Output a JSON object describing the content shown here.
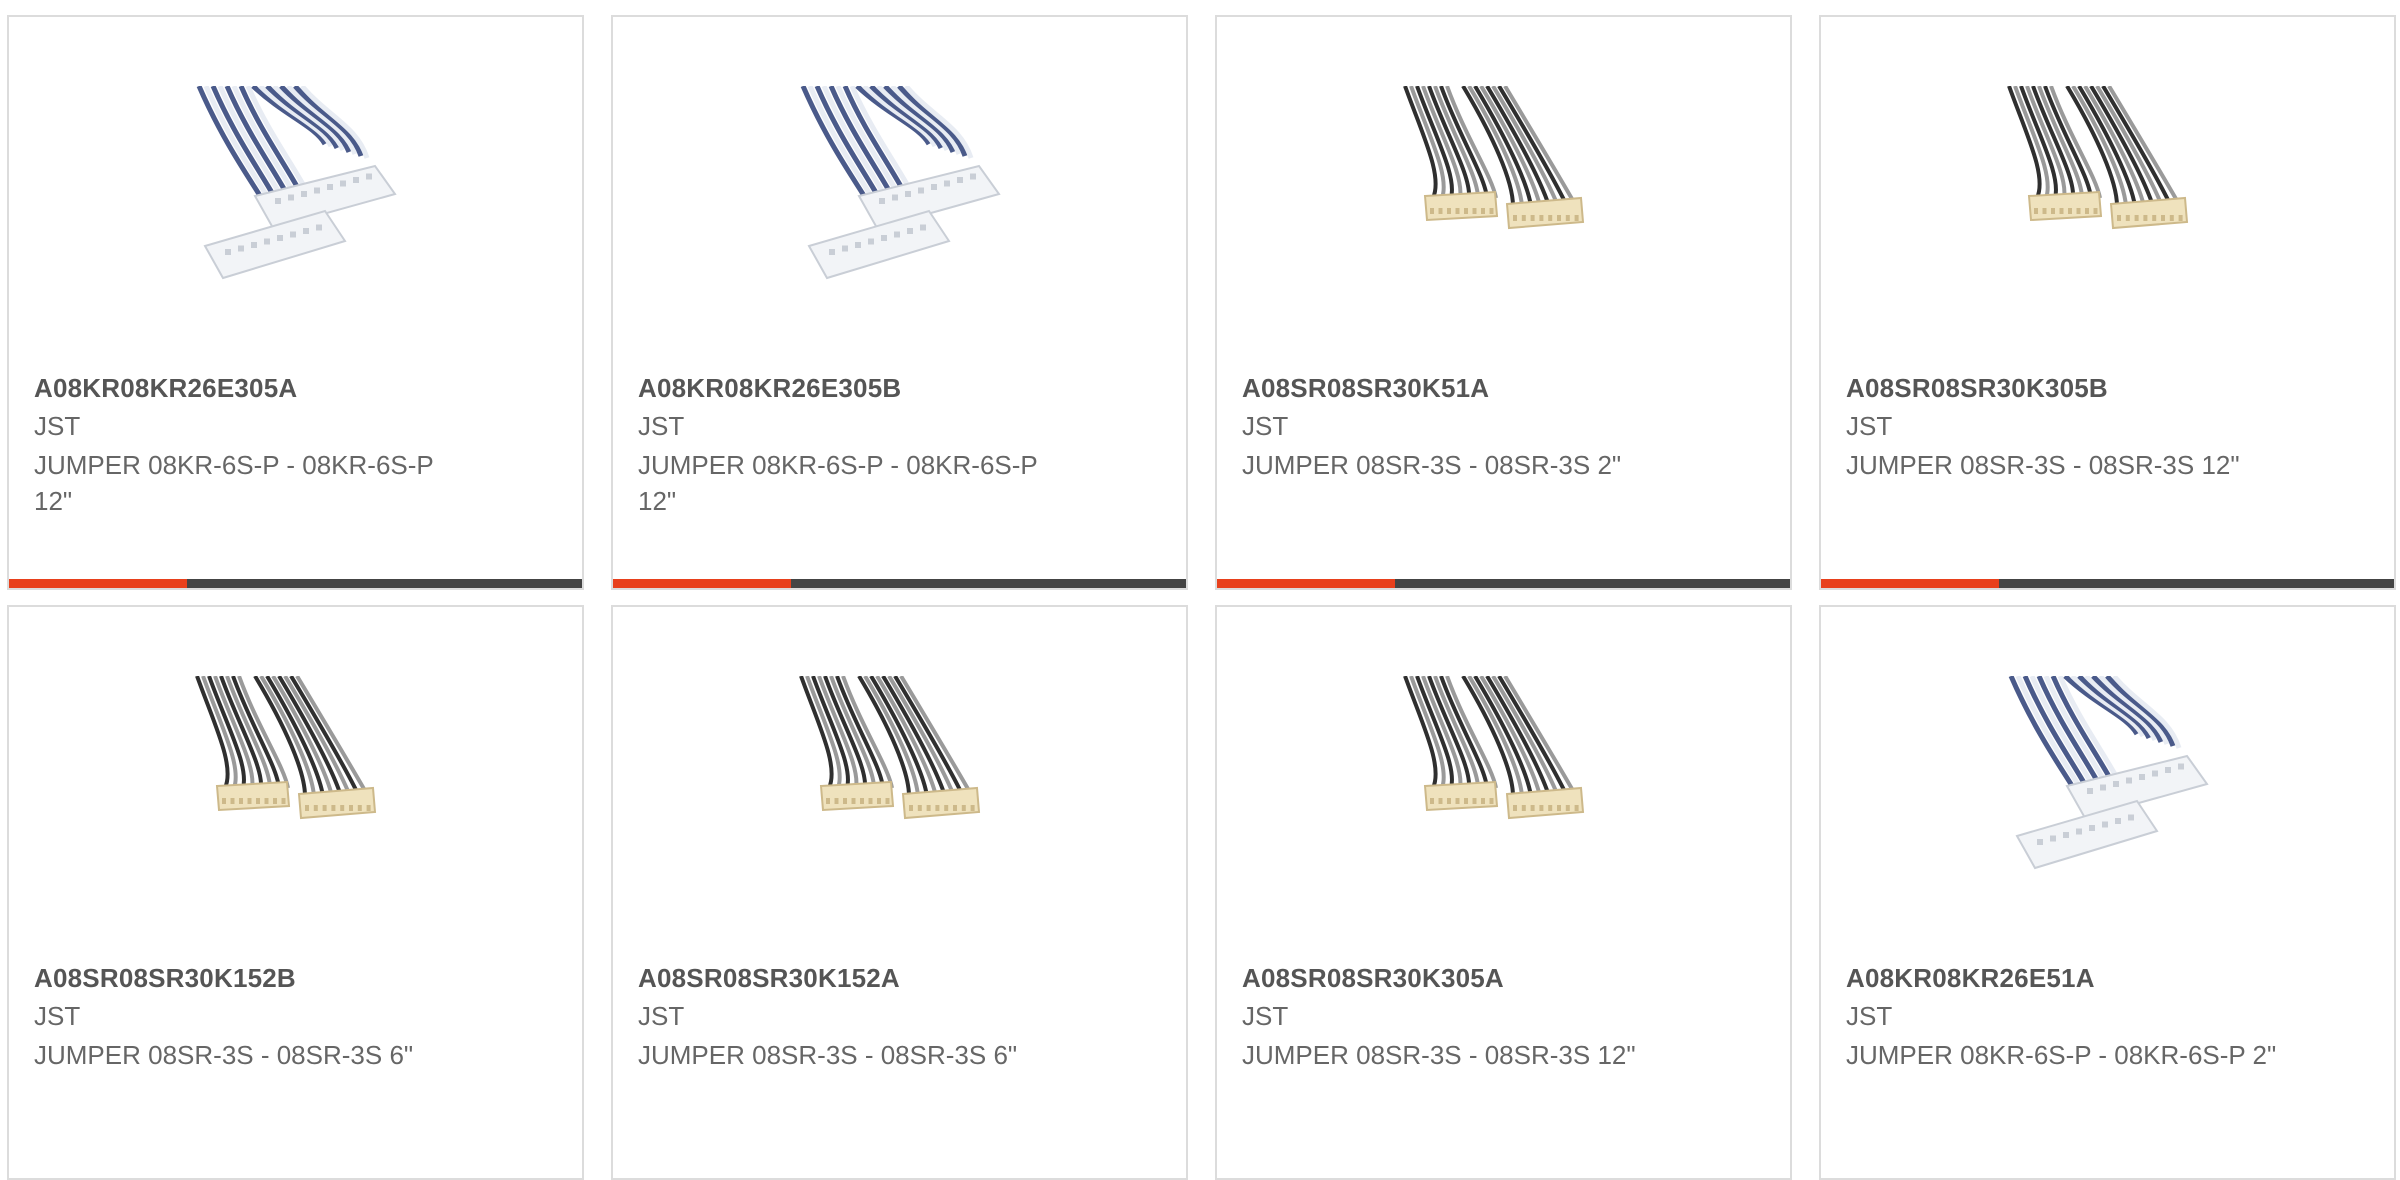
{
  "colors": {
    "accent": "#e8401c",
    "bar_dark": "#444444",
    "border": "#dcdcdc",
    "text_primary": "#555555",
    "text_secondary": "#666666"
  },
  "products": [
    {
      "part_number": "A08KR08KR26E305A",
      "manufacturer": "JST",
      "description": "JUMPER 08KR-6S-P - 08KR-6S-P 12\"",
      "image_icon": "blue-jumper-cable-icon",
      "progress": 0.31
    },
    {
      "part_number": "A08KR08KR26E305B",
      "manufacturer": "JST",
      "description": "JUMPER 08KR-6S-P - 08KR-6S-P 12\"",
      "image_icon": "blue-jumper-cable-icon",
      "progress": 0.31
    },
    {
      "part_number": "A08SR08SR30K51A",
      "manufacturer": "JST",
      "description": "JUMPER 08SR-3S - 08SR-3S 2\"",
      "image_icon": "black-jumper-cable-icon",
      "progress": 0.31
    },
    {
      "part_number": "A08SR08SR30K305B",
      "manufacturer": "JST",
      "description": "JUMPER 08SR-3S - 08SR-3S 12\"",
      "image_icon": "black-jumper-cable-icon",
      "progress": 0.31
    },
    {
      "part_number": "A08SR08SR30K152B",
      "manufacturer": "JST",
      "description": "JUMPER 08SR-3S - 08SR-3S 6\"",
      "image_icon": "black-jumper-cable-icon"
    },
    {
      "part_number": "A08SR08SR30K152A",
      "manufacturer": "JST",
      "description": "JUMPER 08SR-3S - 08SR-3S 6\"",
      "image_icon": "black-jumper-cable-icon"
    },
    {
      "part_number": "A08SR08SR30K305A",
      "manufacturer": "JST",
      "description": "JUMPER 08SR-3S - 08SR-3S 12\"",
      "image_icon": "black-jumper-cable-icon"
    },
    {
      "part_number": "A08KR08KR26E51A",
      "manufacturer": "JST",
      "description": "JUMPER 08KR-6S-P - 08KR-6S-P 2\"",
      "image_icon": "blue-jumper-cable-icon"
    }
  ]
}
